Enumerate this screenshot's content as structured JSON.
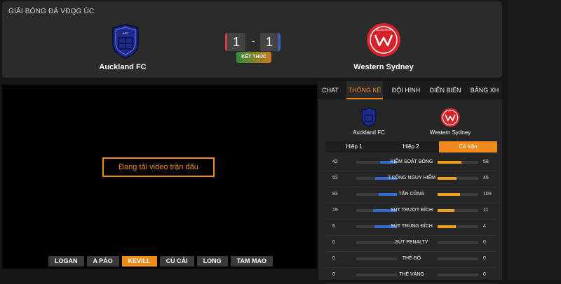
{
  "header": {
    "league": "GIẢI BÓNG ĐÁ VĐQG ÚC",
    "home_team": "Auckland FC",
    "away_team": "Western Sydney",
    "home_score": "1",
    "away_score": "1",
    "score_separator": "-",
    "status": "KẾT THÚC",
    "home_crest_label": "AFC",
    "away_crest_label": "WANDERERS"
  },
  "video": {
    "loading_text": "Đang tải video trận đấu",
    "servers": [
      "LOGAN",
      "A PÁO",
      "KEVILL",
      "CỦ CẢI",
      "LONG",
      "TAM MAO"
    ],
    "active_server_index": 2
  },
  "panel": {
    "tabs": [
      "CHAT",
      "THỐNG KÊ",
      "ĐỘI HÌNH",
      "DIỄN BIẾN",
      "BẢNG XH"
    ],
    "active_tab_index": 1,
    "home_team": "Auckland FC",
    "away_team": "Western Sydney",
    "periods": [
      "Hiệp 1",
      "Hiệp 2",
      "Cả trận"
    ],
    "active_period_index": 2,
    "stats": [
      {
        "label": "KIỂM SOÁT BÓNG",
        "home": "42",
        "away": "58",
        "home_frac": 0.42,
        "away_frac": 0.58
      },
      {
        "label": "T.CÔNG NGUY HIỂM",
        "home": "52",
        "away": "45",
        "home_frac": 0.54,
        "away_frac": 0.46
      },
      {
        "label": "TẤN CÔNG",
        "home": "82",
        "away": "100",
        "home_frac": 0.45,
        "away_frac": 0.55
      },
      {
        "label": "SÚT TRƯỢT ĐÍCH",
        "home": "15",
        "away": "11",
        "home_frac": 0.58,
        "away_frac": 0.42
      },
      {
        "label": "SÚT TRÚNG ĐÍCH",
        "home": "5",
        "away": "4",
        "home_frac": 0.56,
        "away_frac": 0.44
      },
      {
        "label": "SÚT PENALTY",
        "home": "0",
        "away": "0",
        "home_frac": 0,
        "away_frac": 0
      },
      {
        "label": "THẺ ĐỎ",
        "home": "0",
        "away": "0",
        "home_frac": 0,
        "away_frac": 0
      },
      {
        "label": "THẺ VÀNG",
        "home": "0",
        "away": "0",
        "home_frac": 0,
        "away_frac": 0
      }
    ]
  },
  "colors": {
    "accent": "#f08a1c",
    "home_bar": "#2f6ad0",
    "away_bar": "#f0a11c",
    "auckland_blue": "#1c2a8c",
    "wsw_red": "#d8222a"
  }
}
